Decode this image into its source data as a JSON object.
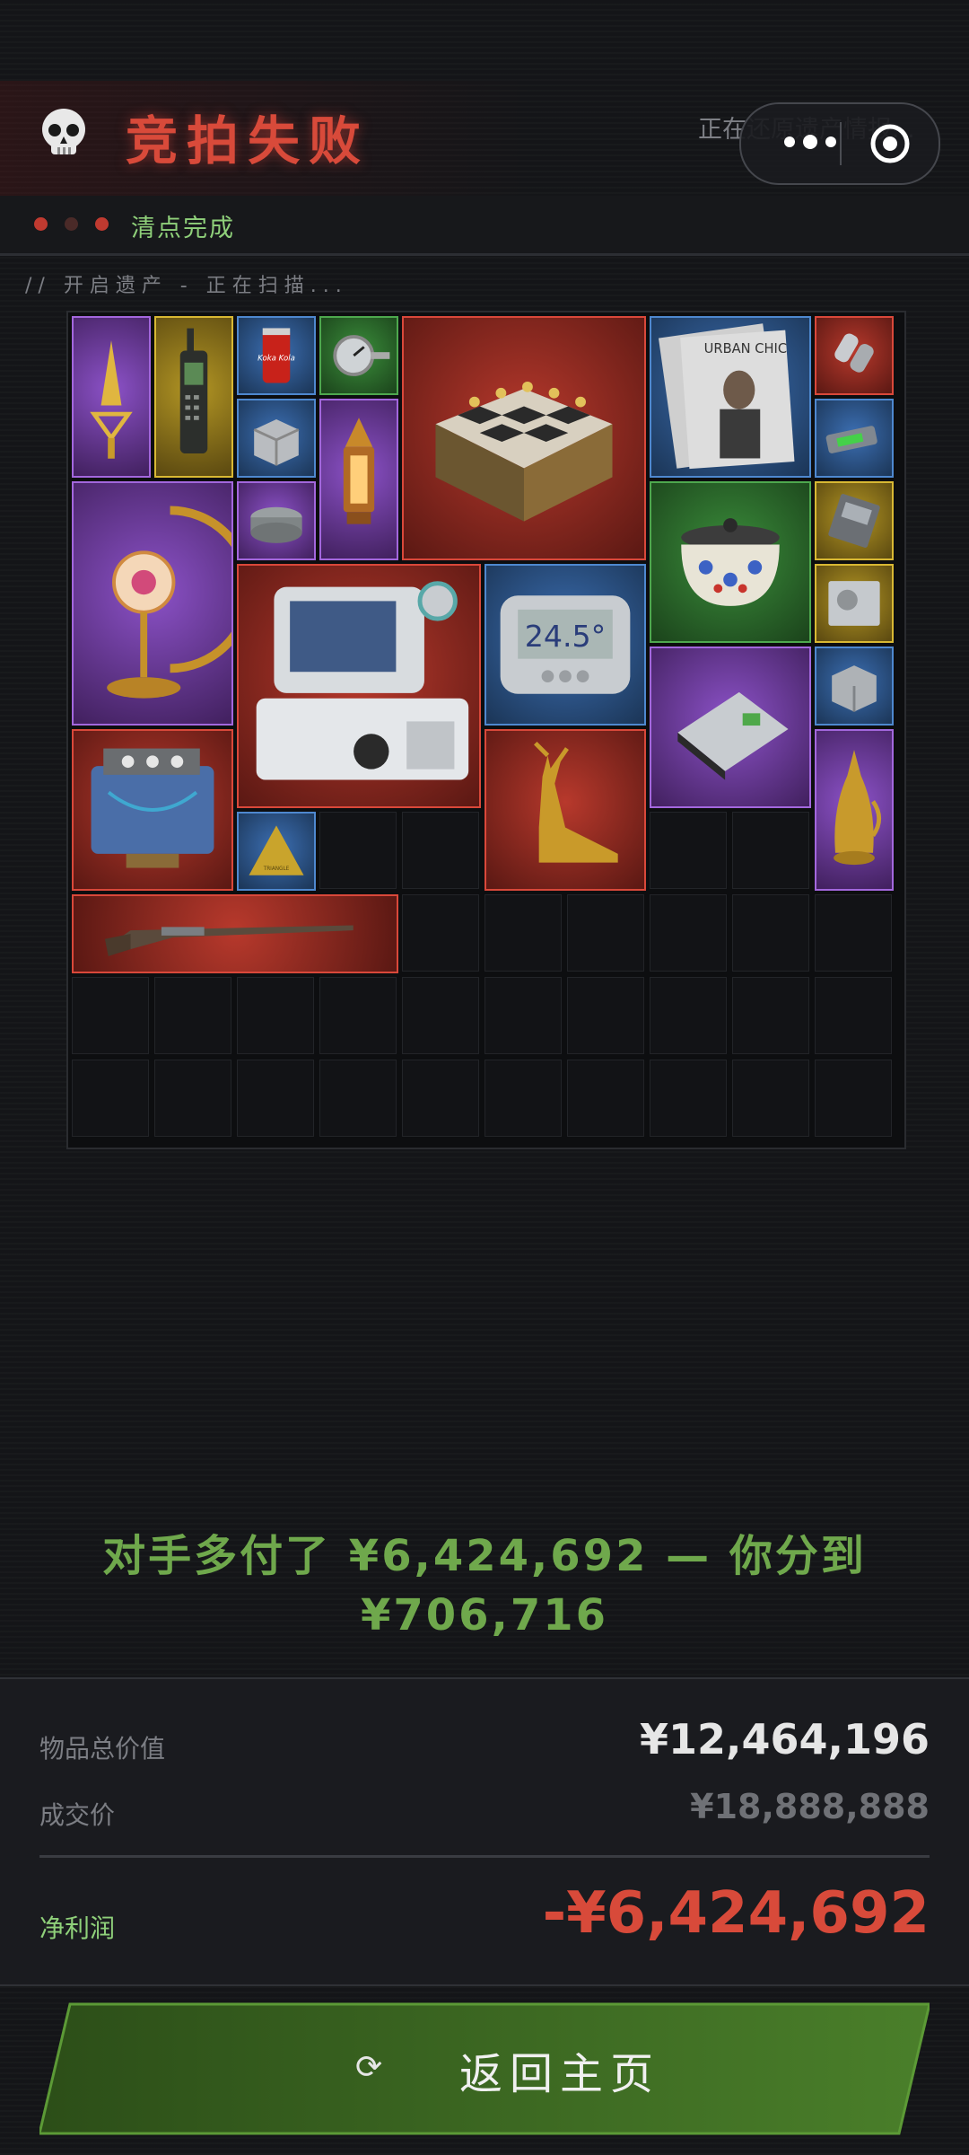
{
  "header": {
    "title": "竞拍失败",
    "restoring_text": "正在还原遗产情报..."
  },
  "status": {
    "text": "清点完成",
    "dots": [
      "#c03a30",
      "#4a2a28",
      "#c03a30"
    ]
  },
  "scan_text": "// 开启遗产 - 正在扫描...",
  "inventory": {
    "columns": 10,
    "rows": 10,
    "items": [
      {
        "name": "golden-triangle-ornament",
        "rarity": "purple"
      },
      {
        "name": "satellite-phone",
        "rarity": "yellow"
      },
      {
        "name": "cola-can",
        "rarity": "blue",
        "label": "Koka Kola"
      },
      {
        "name": "pressure-gauge",
        "rarity": "green"
      },
      {
        "name": "chess-set-box",
        "rarity": "red"
      },
      {
        "name": "urban-chic-magazine",
        "rarity": "blue",
        "label": "URBAN CHIC"
      },
      {
        "name": "dog-tags",
        "rarity": "red"
      },
      {
        "name": "metal-container",
        "rarity": "blue"
      },
      {
        "name": "arabian-lantern",
        "rarity": "purple"
      },
      {
        "name": "usb-drive",
        "rarity": "blue"
      },
      {
        "name": "moon-lamp",
        "rarity": "purple"
      },
      {
        "name": "tea-tin",
        "rarity": "purple"
      },
      {
        "name": "patterned-pot",
        "rarity": "green"
      },
      {
        "name": "hard-drive",
        "rarity": "yellow"
      },
      {
        "name": "medical-monitor",
        "rarity": "red"
      },
      {
        "name": "digital-thermometer",
        "rarity": "blue",
        "label": "24.5°"
      },
      {
        "name": "disk-drive",
        "rarity": "yellow"
      },
      {
        "name": "ssd-drive",
        "rarity": "purple"
      },
      {
        "name": "metal-box",
        "rarity": "blue"
      },
      {
        "name": "engine-block",
        "rarity": "red"
      },
      {
        "name": "triangle-badge",
        "rarity": "blue",
        "label": "TRIANGLE"
      },
      {
        "name": "golden-deer-statue",
        "rarity": "red"
      },
      {
        "name": "golden-ewer",
        "rarity": "purple"
      },
      {
        "name": "antique-musket",
        "rarity": "red"
      }
    ]
  },
  "summary": {
    "line1": "对手多付了 ¥6,424,692 — 你分到",
    "line2": "¥706,716"
  },
  "results": {
    "total_value_label": "物品总价值",
    "total_value": "¥12,464,196",
    "deal_price_label": "成交价",
    "deal_price": "¥18,888,888",
    "net_profit_label": "净利润",
    "net_profit": "-¥6,424,692"
  },
  "button": {
    "label": "返回主页",
    "icon": "refresh-icon"
  },
  "colors": {
    "title": "#d84a3a",
    "status": "#8fd07a",
    "summary": "#6fa84c",
    "loss": "#d84a3a",
    "button": "#3d6a22"
  }
}
